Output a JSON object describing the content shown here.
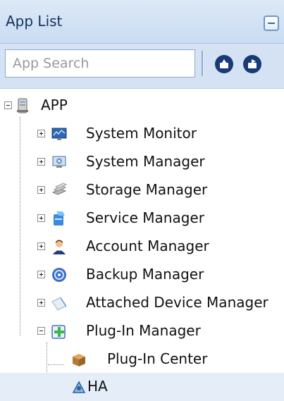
{
  "panel": {
    "title": "App List",
    "collapse_icon": "minus-icon"
  },
  "toolbar": {
    "search_placeholder": "App Search",
    "button_icons": [
      "upload-circle-icon",
      "refresh-circle-icon"
    ]
  },
  "tree": {
    "root": {
      "label": "APP",
      "icon": "server-icon",
      "expanded": true
    },
    "items": [
      {
        "label": "System Monitor",
        "icon": "monitor-chart-icon",
        "expanded": false
      },
      {
        "label": "System Manager",
        "icon": "computer-settings-icon",
        "expanded": false
      },
      {
        "label": "Storage Manager",
        "icon": "storage-disks-icon",
        "expanded": false
      },
      {
        "label": "Service Manager",
        "icon": "service-icon",
        "expanded": false
      },
      {
        "label": "Account Manager",
        "icon": "user-account-icon",
        "expanded": false
      },
      {
        "label": "Backup Manager",
        "icon": "backup-disc-icon",
        "expanded": false
      },
      {
        "label": "Attached Device Manager",
        "icon": "attached-device-icon",
        "expanded": false
      },
      {
        "label": "Plug-In Manager",
        "icon": "plugin-puzzle-icon",
        "expanded": true
      }
    ],
    "plugin_children": [
      {
        "label": "Plug-In Center",
        "icon": "package-box-icon"
      },
      {
        "label": "HA",
        "icon": "ha-cluster-icon",
        "selected": true
      }
    ]
  },
  "colors": {
    "header_bg": "#c9dcf2",
    "selection_bg": "#e5eef8",
    "toolbar_button": "#173c73"
  }
}
